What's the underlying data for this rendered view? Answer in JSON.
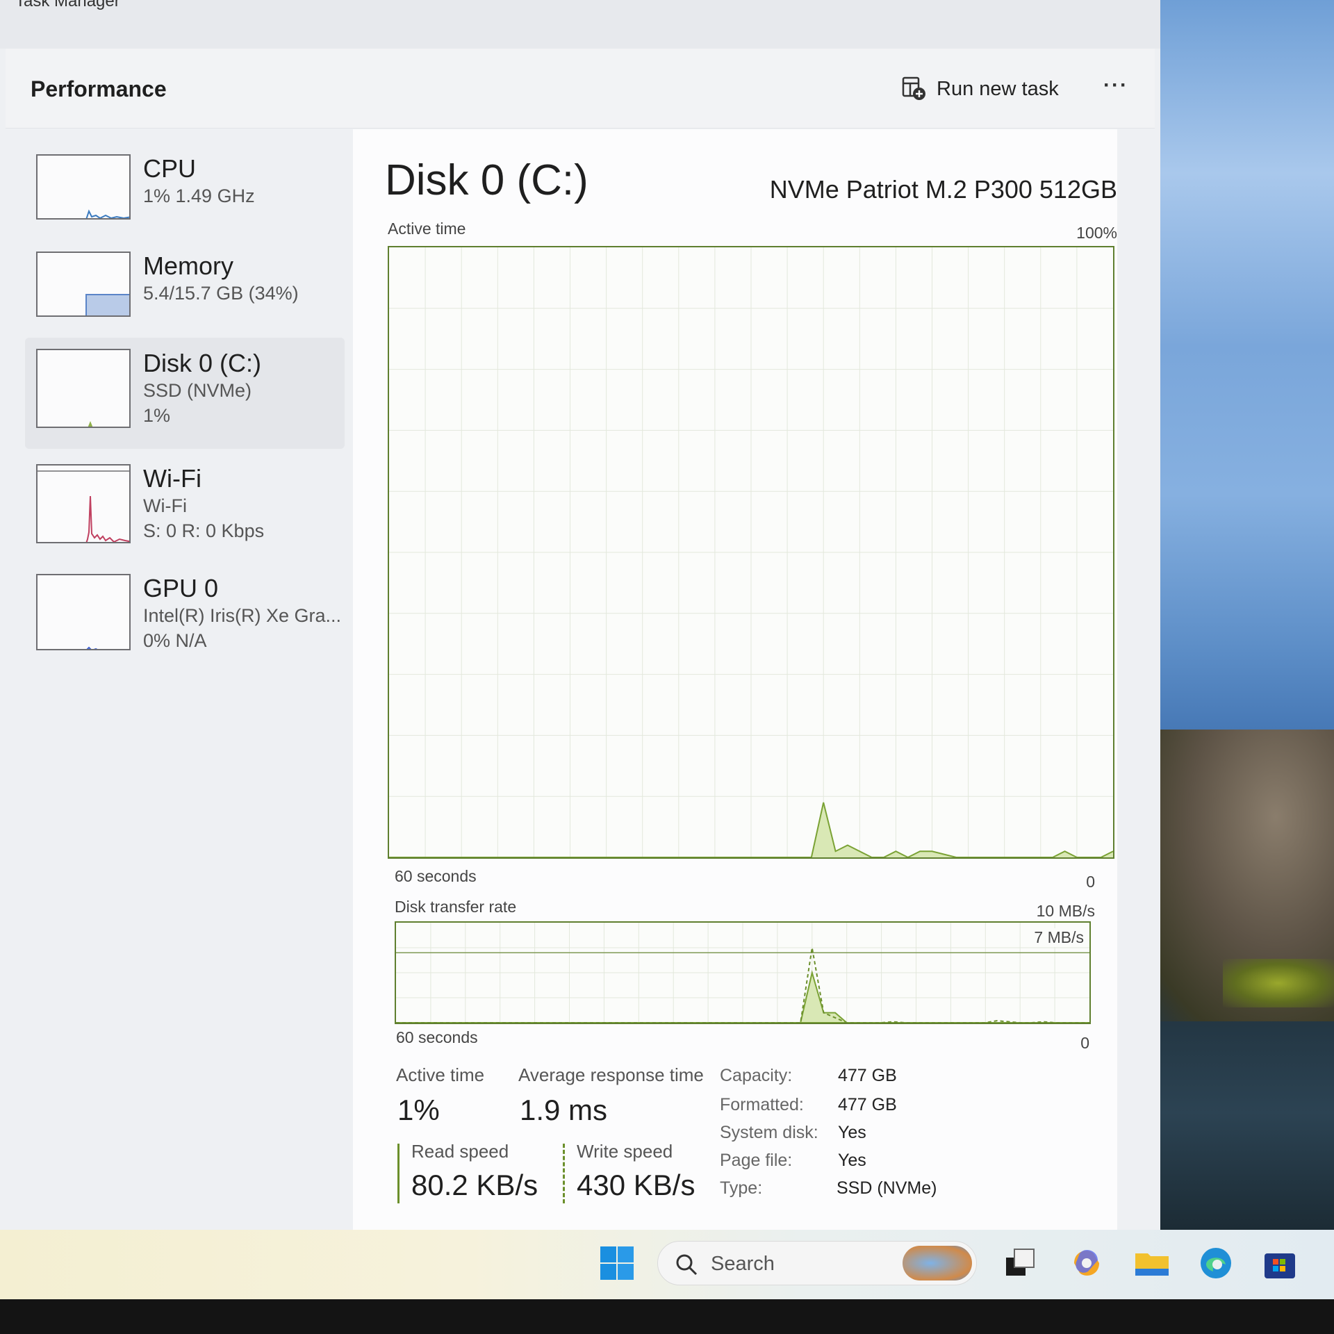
{
  "window": {
    "title": "Task Manager"
  },
  "header": {
    "title": "Performance",
    "run_task_label": "Run new task",
    "more_label": "···"
  },
  "sidebar": {
    "items": [
      {
        "id": "cpu",
        "title": "CPU",
        "line1": "1%  1.49 GHz",
        "line2": ""
      },
      {
        "id": "memory",
        "title": "Memory",
        "line1": "5.4/15.7 GB (34%)",
        "line2": ""
      },
      {
        "id": "disk",
        "title": "Disk 0 (C:)",
        "line1": "SSD (NVMe)",
        "line2": "1%"
      },
      {
        "id": "wifi",
        "title": "Wi-Fi",
        "line1": "Wi-Fi",
        "line2": "S: 0 R: 0 Kbps"
      },
      {
        "id": "gpu",
        "title": "GPU 0",
        "line1": "Intel(R) Iris(R) Xe Gra...",
        "line2": "0% N/A"
      }
    ],
    "selected": "disk"
  },
  "main": {
    "title": "Disk 0 (C:)",
    "model": "NVMe Patriot M.2 P300 512GB",
    "active_graph": {
      "label": "Active time",
      "max_label": "100%",
      "x_left": "60 seconds",
      "x_right": "0"
    },
    "transfer_graph": {
      "label": "Disk transfer rate",
      "max_label": "10 MB/s",
      "mid_label": "7 MB/s",
      "x_left": "60 seconds",
      "x_right": "0"
    },
    "stats": {
      "active_time_label": "Active time",
      "active_time_value": "1%",
      "avg_response_label": "Average response time",
      "avg_response_value": "1.9 ms",
      "read_label": "Read speed",
      "read_value": "80.2 KB/s",
      "write_label": "Write speed",
      "write_value": "430 KB/s"
    },
    "properties": [
      {
        "key": "Capacity:",
        "value": "477 GB"
      },
      {
        "key": "Formatted:",
        "value": "477 GB"
      },
      {
        "key": "System disk:",
        "value": "Yes"
      },
      {
        "key": "Page file:",
        "value": "Yes"
      },
      {
        "key": "Type:",
        "value": "SSD (NVMe)"
      }
    ]
  },
  "taskbar": {
    "search_placeholder": "Search"
  },
  "chart_data": [
    {
      "type": "area",
      "title": "Active time",
      "ylim": [
        0,
        100
      ],
      "x": [
        60,
        25,
        24,
        23,
        22,
        21,
        20,
        19,
        18,
        17,
        16,
        15,
        13,
        12,
        10,
        9,
        8,
        6,
        5,
        4,
        3,
        2,
        1,
        0
      ],
      "values": [
        0,
        0,
        9,
        1,
        2,
        1,
        0,
        0,
        1,
        0,
        1,
        1,
        0,
        0,
        0,
        0,
        0,
        0,
        0,
        1,
        0,
        0,
        0,
        1
      ]
    },
    {
      "type": "line",
      "title": "Disk transfer rate",
      "ylim": [
        0,
        10
      ],
      "series": [
        {
          "values": [
            0,
            0,
            5,
            1,
            1,
            0,
            0,
            0,
            0,
            0,
            0,
            0,
            0,
            0,
            0,
            0,
            0,
            0,
            0,
            0,
            0,
            0,
            0,
            0
          ]
        },
        {
          "values": [
            0,
            0,
            7.5,
            1,
            0.5,
            0,
            0,
            0,
            0,
            0.1,
            0,
            0,
            0,
            0,
            0,
            0,
            0.2,
            0,
            0,
            0.1,
            0,
            0,
            0,
            0
          ]
        }
      ]
    }
  ]
}
